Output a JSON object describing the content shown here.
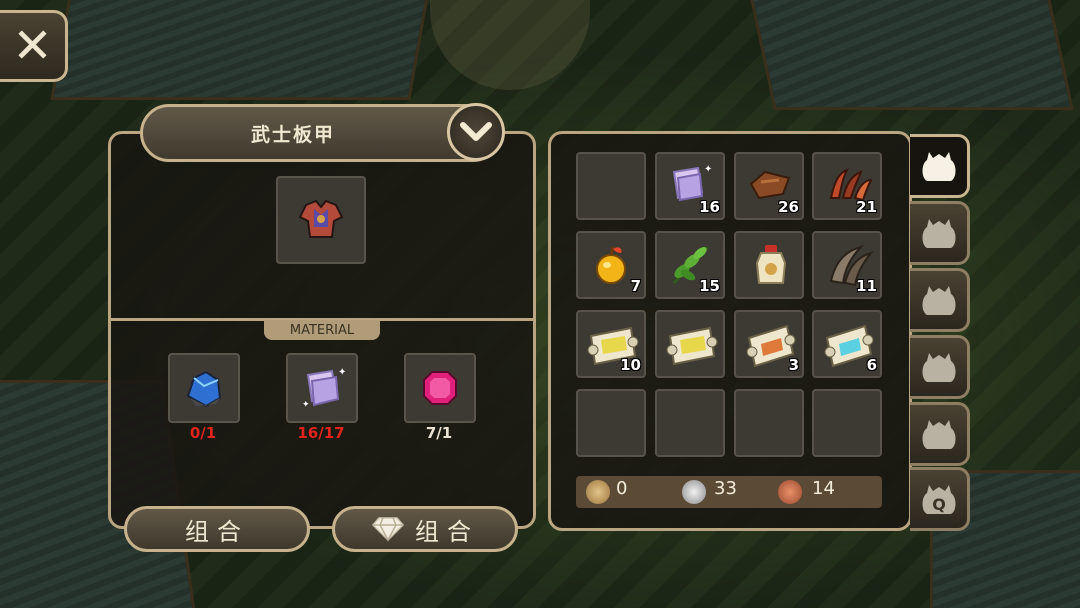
{
  "close_button": {
    "label": "✕"
  },
  "craft": {
    "title": "武士板甲",
    "material_label": "MATERIAL",
    "materials": [
      {
        "name": "blue-ore",
        "count": "0/1",
        "count_color": "#e3241c"
      },
      {
        "name": "magic-paper",
        "count": "16/17",
        "count_color": "#e3241c"
      },
      {
        "name": "ruby-gem",
        "count": "7/1",
        "count_color": "#ebe4d4"
      }
    ],
    "combine_label": "组合",
    "gem_combine_label": "组合"
  },
  "inventory": {
    "rows": [
      [
        {
          "icon": "empty",
          "qty": ""
        },
        {
          "icon": "magic-paper-icon",
          "qty": "16"
        },
        {
          "icon": "leather-icon",
          "qty": "26"
        },
        {
          "icon": "claw-icon",
          "qty": "21"
        }
      ],
      [
        {
          "icon": "golden-apple-icon",
          "qty": "7"
        },
        {
          "icon": "leaf-icon",
          "qty": "15"
        },
        {
          "icon": "potion-jar-icon",
          "qty": ""
        },
        {
          "icon": "horn-icon",
          "qty": "11"
        }
      ],
      [
        {
          "icon": "scroll-yellow-icon",
          "qty": "10"
        },
        {
          "icon": "scroll-yellow-icon",
          "qty": ""
        },
        {
          "icon": "scroll-red-icon",
          "qty": "3"
        },
        {
          "icon": "scroll-blue-icon",
          "qty": "6"
        }
      ],
      [
        {
          "icon": "empty",
          "qty": ""
        },
        {
          "icon": "empty",
          "qty": ""
        },
        {
          "icon": "empty",
          "qty": ""
        },
        {
          "icon": "empty",
          "qty": ""
        }
      ]
    ],
    "currency": {
      "gold": "0",
      "silver": "33",
      "copper": "14"
    },
    "tabs": [
      {
        "icon": "bag-icon",
        "active": true
      },
      {
        "icon": "bag-icon",
        "active": false
      },
      {
        "icon": "bag-icon",
        "active": false
      },
      {
        "icon": "bag-icon",
        "active": false
      },
      {
        "icon": "bag-icon",
        "active": false
      },
      {
        "icon": "quest-bag-icon",
        "active": false,
        "letter": "Q"
      }
    ]
  }
}
